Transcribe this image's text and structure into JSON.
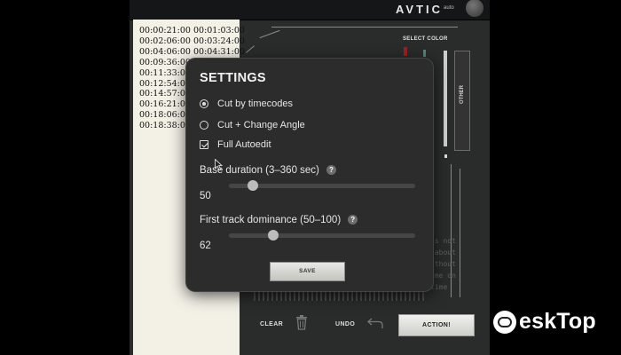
{
  "app": {
    "brand": "AVTIC",
    "brand_sup": "auto",
    "select_color_label": "SELECT COLOR",
    "other_label": "OTHER",
    "background_text": "is not\n about\nithout\nlme on\ntime"
  },
  "timecodes": [
    "00:00:21:00 00:01:03:00",
    "00:02:06:00 00:03:24:00",
    "00:04:06:00 00:04:31:00",
    "00:09:36:00",
    "00:11:33:00",
    "00:12:54:00",
    "00:14:57:00",
    "00:16:21:00",
    "00:18:06:00",
    "00:18:38:00"
  ],
  "settings": {
    "title": "SETTINGS",
    "options": [
      {
        "label": "Cut by timecodes",
        "type": "radio",
        "selected": true
      },
      {
        "label": "Cut + Change Angle",
        "type": "radio",
        "selected": false
      },
      {
        "label": "Full Autoedit",
        "type": "checkbox",
        "checked": true
      }
    ],
    "base_duration": {
      "label": "Base duration (3–360 sec)",
      "help": "?",
      "value": "50",
      "fraction": 0.13
    },
    "first_track_dominance": {
      "label": "First track dominance (50–100)",
      "help": "?",
      "value": "62",
      "fraction": 0.24
    },
    "save_label": "SAVE"
  },
  "toolbar": {
    "clear_label": "CLEAR",
    "undo_label": "UNDO",
    "action_label": "ACTION!"
  },
  "watermark": {
    "text": "eskTop"
  }
}
